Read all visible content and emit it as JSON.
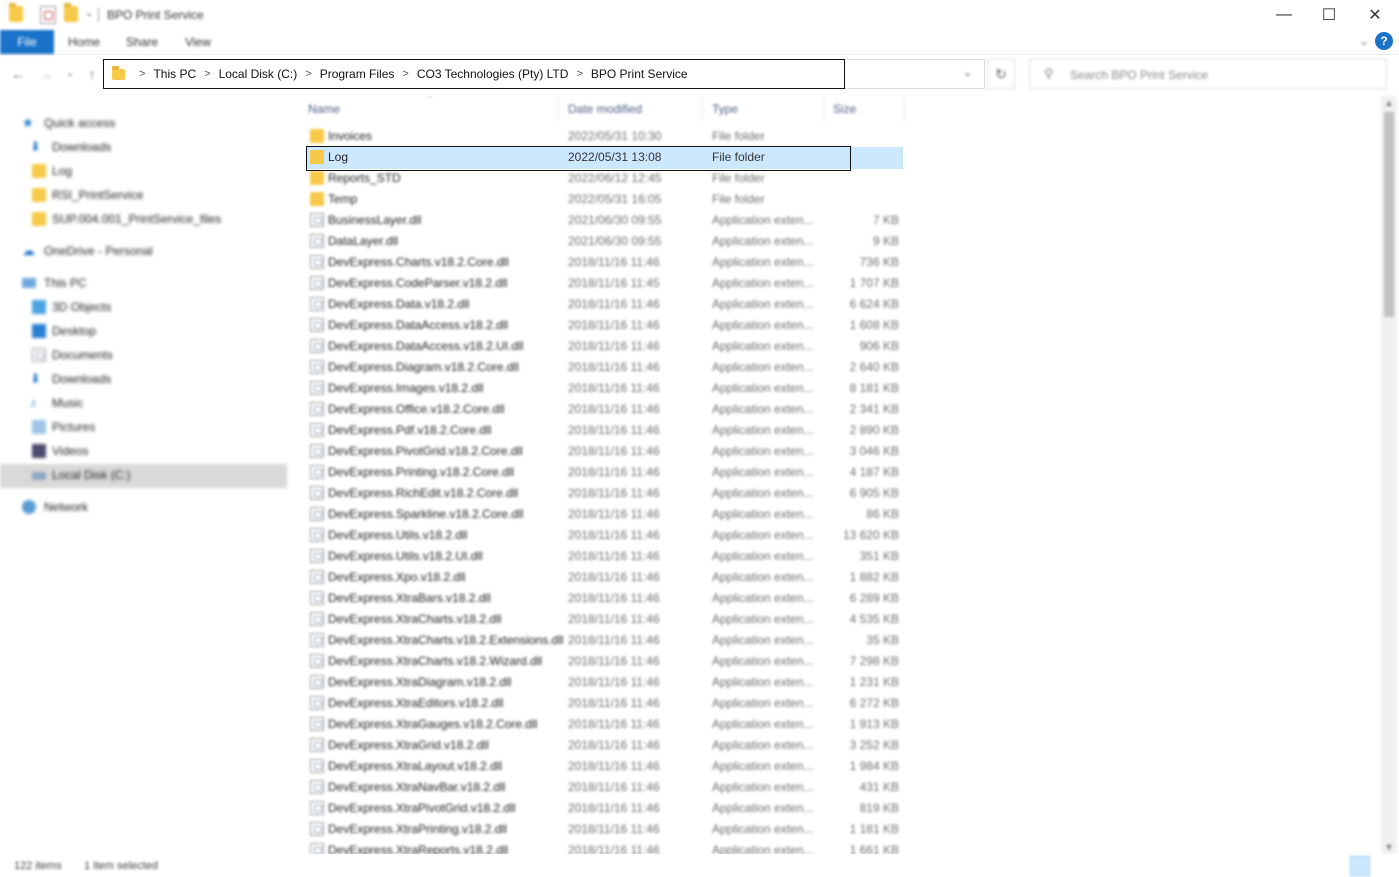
{
  "window": {
    "title": "BPO Print Service",
    "minimize_glyph": "—",
    "maximize_glyph": "☐",
    "close_glyph": "✕"
  },
  "ribbon": {
    "tabs": [
      "File",
      "Home",
      "Share",
      "View"
    ],
    "help_glyph": "?",
    "expand_glyph": "⌄"
  },
  "nav": {
    "back_glyph": "←",
    "forward_glyph": "→",
    "recent_glyph": "⌄",
    "up_glyph": "↑",
    "breadcrumbs": [
      "This PC",
      "Local Disk (C:)",
      "Program Files",
      "CO3 Technologies (Pty) LTD",
      "BPO Print Service"
    ],
    "crumb_separator": ">",
    "dropdown_glyph": "⌄",
    "refresh_glyph": "↻",
    "search_placeholder": "Search BPO Print Service",
    "search_glyph": "⚲"
  },
  "sidebar": {
    "quick_access": "Quick access",
    "quick_items": [
      "Downloads",
      "Log",
      "RSI_PrintService",
      "SUP.004.001_PrintService_files"
    ],
    "onedrive": "OneDrive - Personal",
    "this_pc": "This PC",
    "pc_items": [
      "3D Objects",
      "Desktop",
      "Documents",
      "Downloads",
      "Music",
      "Pictures",
      "Videos",
      "Local Disk (C:)"
    ],
    "network": "Network"
  },
  "columns": {
    "name": "Name",
    "date": "Date modified",
    "type": "Type",
    "size": "Size"
  },
  "files": [
    {
      "name": "Invoices",
      "date": "2022/05/31 10:30",
      "type": "File folder",
      "size": "",
      "kind": "folder"
    },
    {
      "name": "Log",
      "date": "2022/05/31 13:08",
      "type": "File folder",
      "size": "",
      "kind": "folder"
    },
    {
      "name": "Reports_STD",
      "date": "2022/06/12 12:45",
      "type": "File folder",
      "size": "",
      "kind": "folder"
    },
    {
      "name": "Temp",
      "date": "2022/05/31 16:05",
      "type": "File folder",
      "size": "",
      "kind": "folder"
    },
    {
      "name": "BusinessLayer.dll",
      "date": "2021/06/30 09:55",
      "type": "Application exten...",
      "size": "7 KB",
      "kind": "dll"
    },
    {
      "name": "DataLayer.dll",
      "date": "2021/06/30 09:55",
      "type": "Application exten...",
      "size": "9 KB",
      "kind": "dll"
    },
    {
      "name": "DevExpress.Charts.v18.2.Core.dll",
      "date": "2018/11/16 11:46",
      "type": "Application exten...",
      "size": "736 KB",
      "kind": "dll"
    },
    {
      "name": "DevExpress.CodeParser.v18.2.dll",
      "date": "2018/11/16 11:45",
      "type": "Application exten...",
      "size": "1 707 KB",
      "kind": "dll"
    },
    {
      "name": "DevExpress.Data.v18.2.dll",
      "date": "2018/11/16 11:46",
      "type": "Application exten...",
      "size": "6 624 KB",
      "kind": "dll"
    },
    {
      "name": "DevExpress.DataAccess.v18.2.dll",
      "date": "2018/11/16 11:46",
      "type": "Application exten...",
      "size": "1 608 KB",
      "kind": "dll"
    },
    {
      "name": "DevExpress.DataAccess.v18.2.UI.dll",
      "date": "2018/11/16 11:46",
      "type": "Application exten...",
      "size": "906 KB",
      "kind": "dll"
    },
    {
      "name": "DevExpress.Diagram.v18.2.Core.dll",
      "date": "2018/11/16 11:46",
      "type": "Application exten...",
      "size": "2 640 KB",
      "kind": "dll"
    },
    {
      "name": "DevExpress.Images.v18.2.dll",
      "date": "2018/11/16 11:46",
      "type": "Application exten...",
      "size": "8 181 KB",
      "kind": "dll"
    },
    {
      "name": "DevExpress.Office.v18.2.Core.dll",
      "date": "2018/11/16 11:46",
      "type": "Application exten...",
      "size": "2 341 KB",
      "kind": "dll"
    },
    {
      "name": "DevExpress.Pdf.v18.2.Core.dll",
      "date": "2018/11/16 11:46",
      "type": "Application exten...",
      "size": "2 890 KB",
      "kind": "dll"
    },
    {
      "name": "DevExpress.PivotGrid.v18.2.Core.dll",
      "date": "2018/11/16 11:46",
      "type": "Application exten...",
      "size": "3 046 KB",
      "kind": "dll"
    },
    {
      "name": "DevExpress.Printing.v18.2.Core.dll",
      "date": "2018/11/16 11:46",
      "type": "Application exten...",
      "size": "4 187 KB",
      "kind": "dll"
    },
    {
      "name": "DevExpress.RichEdit.v18.2.Core.dll",
      "date": "2018/11/16 11:46",
      "type": "Application exten...",
      "size": "6 905 KB",
      "kind": "dll"
    },
    {
      "name": "DevExpress.Sparkline.v18.2.Core.dll",
      "date": "2018/11/16 11:46",
      "type": "Application exten...",
      "size": "86 KB",
      "kind": "dll"
    },
    {
      "name": "DevExpress.Utils.v18.2.dll",
      "date": "2018/11/16 11:46",
      "type": "Application exten...",
      "size": "13 620 KB",
      "kind": "dll"
    },
    {
      "name": "DevExpress.Utils.v18.2.UI.dll",
      "date": "2018/11/16 11:46",
      "type": "Application exten...",
      "size": "351 KB",
      "kind": "dll"
    },
    {
      "name": "DevExpress.Xpo.v18.2.dll",
      "date": "2018/11/16 11:46",
      "type": "Application exten...",
      "size": "1 882 KB",
      "kind": "dll"
    },
    {
      "name": "DevExpress.XtraBars.v18.2.dll",
      "date": "2018/11/16 11:46",
      "type": "Application exten...",
      "size": "6 289 KB",
      "kind": "dll"
    },
    {
      "name": "DevExpress.XtraCharts.v18.2.dll",
      "date": "2018/11/16 11:46",
      "type": "Application exten...",
      "size": "4 535 KB",
      "kind": "dll"
    },
    {
      "name": "DevExpress.XtraCharts.v18.2.Extensions.dll",
      "date": "2018/11/16 11:46",
      "type": "Application exten...",
      "size": "35 KB",
      "kind": "dll"
    },
    {
      "name": "DevExpress.XtraCharts.v18.2.Wizard.dll",
      "date": "2018/11/16 11:46",
      "type": "Application exten...",
      "size": "7 298 KB",
      "kind": "dll"
    },
    {
      "name": "DevExpress.XtraDiagram.v18.2.dll",
      "date": "2018/11/16 11:46",
      "type": "Application exten...",
      "size": "1 231 KB",
      "kind": "dll"
    },
    {
      "name": "DevExpress.XtraEditors.v18.2.dll",
      "date": "2018/11/16 11:46",
      "type": "Application exten...",
      "size": "6 272 KB",
      "kind": "dll"
    },
    {
      "name": "DevExpress.XtraGauges.v18.2.Core.dll",
      "date": "2018/11/16 11:46",
      "type": "Application exten...",
      "size": "1 913 KB",
      "kind": "dll"
    },
    {
      "name": "DevExpress.XtraGrid.v18.2.dll",
      "date": "2018/11/16 11:46",
      "type": "Application exten...",
      "size": "3 252 KB",
      "kind": "dll"
    },
    {
      "name": "DevExpress.XtraLayout.v18.2.dll",
      "date": "2018/11/16 11:46",
      "type": "Application exten...",
      "size": "1 984 KB",
      "kind": "dll"
    },
    {
      "name": "DevExpress.XtraNavBar.v18.2.dll",
      "date": "2018/11/16 11:46",
      "type": "Application exten...",
      "size": "431 KB",
      "kind": "dll"
    },
    {
      "name": "DevExpress.XtraPivotGrid.v18.2.dll",
      "date": "2018/11/16 11:46",
      "type": "Application exten...",
      "size": "819 KB",
      "kind": "dll"
    },
    {
      "name": "DevExpress.XtraPrinting.v18.2.dll",
      "date": "2018/11/16 11:46",
      "type": "Application exten...",
      "size": "1 181 KB",
      "kind": "dll"
    },
    {
      "name": "DevExpress.XtraReports.v18.2.dll",
      "date": "2018/11/16 11:46",
      "type": "Application exten...",
      "size": "1 661 KB",
      "kind": "dll"
    }
  ],
  "selected_index": 1,
  "status": {
    "count": "122 items",
    "selected": "1 item selected"
  },
  "colors": {
    "accent": "#1a73c9",
    "selection": "#cce8ff",
    "folder": "#f7c948"
  }
}
